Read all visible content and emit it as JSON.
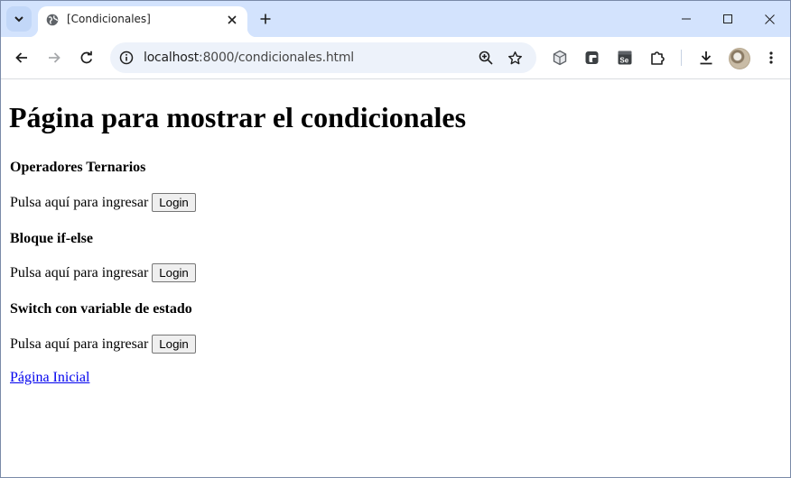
{
  "browser": {
    "tab_title": "[Condicionales]",
    "url_host": "localhost",
    "url_rest": ":8000/condicionales.html",
    "icons": {
      "tab_search": "chevron-down-icon",
      "favicon": "globe-icon",
      "tab_close": "close-icon",
      "new_tab": "plus-icon",
      "minimize": "minimize-icon",
      "maximize": "maximize-icon",
      "close_window": "close-icon",
      "back": "arrow-left-icon",
      "forward": "arrow-right-icon",
      "reload": "reload-icon",
      "site_info": "info-icon",
      "zoom": "zoom-icon",
      "bookmark": "star-icon",
      "extensions_list": [
        "cube-icon",
        "extension-badge-icon",
        "selenium-icon",
        "puzzle-icon"
      ],
      "download": "download-icon",
      "menu": "more-vert-icon"
    },
    "colors": {
      "tabstrip": "#d3e3fd",
      "omnibox": "#edf2fa",
      "link": "#0000ee"
    }
  },
  "page": {
    "title": "Página para mostrar el condicionales",
    "sections": [
      {
        "heading": "Operadores Ternarios",
        "text": "Pulsa aquí para ingresar",
        "button": "Login"
      },
      {
        "heading": "Bloque if-else",
        "text": "Pulsa aquí para ingresar",
        "button": "Login"
      },
      {
        "heading": "Switch con variable de estado",
        "text": "Pulsa aquí para ingresar",
        "button": "Login"
      }
    ],
    "home_link": "Página Inicial"
  }
}
